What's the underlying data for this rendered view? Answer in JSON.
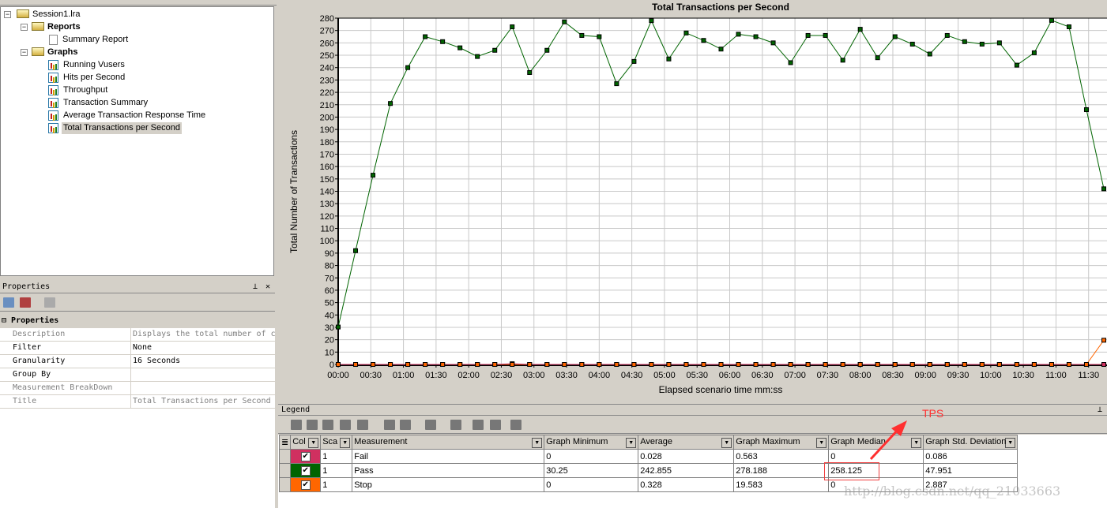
{
  "tree": {
    "root": "Session1.lra",
    "reports": "Reports",
    "summary_report": "Summary Report",
    "graphs": "Graphs",
    "graph_items": [
      "Running Vusers",
      "Hits per Second",
      "Throughput",
      "Transaction Summary",
      "Average Transaction Response Time",
      "Total Transactions per Second"
    ],
    "selected": "Total Transactions per Second"
  },
  "properties": {
    "title": "Properties",
    "section": "Properties",
    "rows": [
      {
        "name": "Description",
        "value": "Displays the total number of c",
        "muted": true
      },
      {
        "name": "Filter",
        "value": "None"
      },
      {
        "name": "Granularity",
        "value": "16 Seconds"
      },
      {
        "name": "Group By",
        "value": ""
      },
      {
        "name": "Measurement BreakDown",
        "value": "",
        "muted": true
      },
      {
        "name": "Title",
        "value": "Total Transactions per Second",
        "muted": true
      }
    ]
  },
  "chart_data": {
    "type": "line",
    "title": "Total Transactions per Second",
    "xlabel": "Elapsed scenario time mm:ss",
    "ylabel": "Total Number of Transactions",
    "ylim": [
      0,
      280
    ],
    "yticks_step": 10,
    "xlim": [
      "00:00",
      "11:44"
    ],
    "xticks": [
      "00:00",
      "00:30",
      "01:00",
      "01:30",
      "02:00",
      "02:30",
      "03:00",
      "03:30",
      "04:00",
      "04:30",
      "05:00",
      "05:30",
      "06:00",
      "06:30",
      "07:00",
      "07:30",
      "08:00",
      "08:30",
      "09:00",
      "09:30",
      "10:00",
      "10:30",
      "11:00",
      "11:30"
    ],
    "grid": true,
    "x": [
      "00:00",
      "00:16",
      "00:32",
      "00:48",
      "01:04",
      "01:20",
      "01:36",
      "01:52",
      "02:08",
      "02:24",
      "02:40",
      "02:56",
      "03:12",
      "03:28",
      "03:44",
      "04:00",
      "04:16",
      "04:32",
      "04:48",
      "05:04",
      "05:20",
      "05:36",
      "05:52",
      "06:08",
      "06:24",
      "06:40",
      "06:56",
      "07:12",
      "07:28",
      "07:44",
      "08:00",
      "08:16",
      "08:32",
      "08:48",
      "09:04",
      "09:20",
      "09:36",
      "09:52",
      "10:08",
      "10:24",
      "10:40",
      "10:56",
      "11:12",
      "11:28",
      "11:44"
    ],
    "series": [
      {
        "name": "Pass",
        "color": "#006400",
        "values": [
          30.25,
          92,
          153,
          211,
          240,
          265,
          261,
          256,
          249,
          254,
          273,
          236,
          254,
          277,
          266,
          265,
          227,
          245,
          278,
          247,
          268,
          262,
          255,
          267,
          265,
          260,
          244,
          266,
          266,
          246,
          271,
          248,
          265,
          259,
          251,
          266,
          261,
          259,
          260,
          242,
          252,
          278.188,
          273,
          206,
          142
        ]
      },
      {
        "name": "Fail",
        "color": "#d03060",
        "values": [
          0,
          0,
          0,
          0,
          0,
          0,
          0,
          0,
          0,
          0,
          0.563,
          0,
          0,
          0,
          0,
          0,
          0,
          0,
          0,
          0,
          0,
          0,
          0,
          0,
          0,
          0,
          0,
          0,
          0,
          0,
          0,
          0,
          0,
          0,
          0,
          0,
          0,
          0,
          0,
          0,
          0,
          0,
          0,
          0,
          0
        ]
      },
      {
        "name": "Stop",
        "color": "#ff6600",
        "values": [
          0,
          0,
          0,
          0,
          0,
          0,
          0,
          0,
          0,
          0,
          0,
          0,
          0,
          0,
          0,
          0,
          0,
          0,
          0,
          0,
          0,
          0,
          0,
          0,
          0,
          0,
          0,
          0,
          0,
          0,
          0,
          0,
          0,
          0,
          0,
          0,
          0,
          0,
          0,
          0,
          0,
          0,
          0,
          0,
          19.583
        ]
      }
    ]
  },
  "legend": {
    "title": "Legend",
    "columns": [
      "Col",
      "Sca",
      "Measurement",
      "Graph Minimum",
      "Average",
      "Graph Maximum",
      "Graph Median",
      "Graph Std. Deviation"
    ],
    "rows": [
      {
        "color": "#d03060",
        "scale": "1",
        "measurement": "Fail",
        "min": "0",
        "avg": "0.028",
        "max": "0.563",
        "median": "0",
        "std": "0.086"
      },
      {
        "color": "#006400",
        "scale": "1",
        "measurement": "Pass",
        "min": "30.25",
        "avg": "242.855",
        "max": "278.188",
        "median": "258.125",
        "std": "47.951"
      },
      {
        "color": "#ff6600",
        "scale": "1",
        "measurement": "Stop",
        "min": "0",
        "avg": "0.328",
        "max": "19.583",
        "median": "0",
        "std": "2.887"
      }
    ]
  },
  "annotation": {
    "label": "TPS",
    "color": "#ff3030"
  },
  "watermark": "http://blog.csdn.net/qq_21033663"
}
